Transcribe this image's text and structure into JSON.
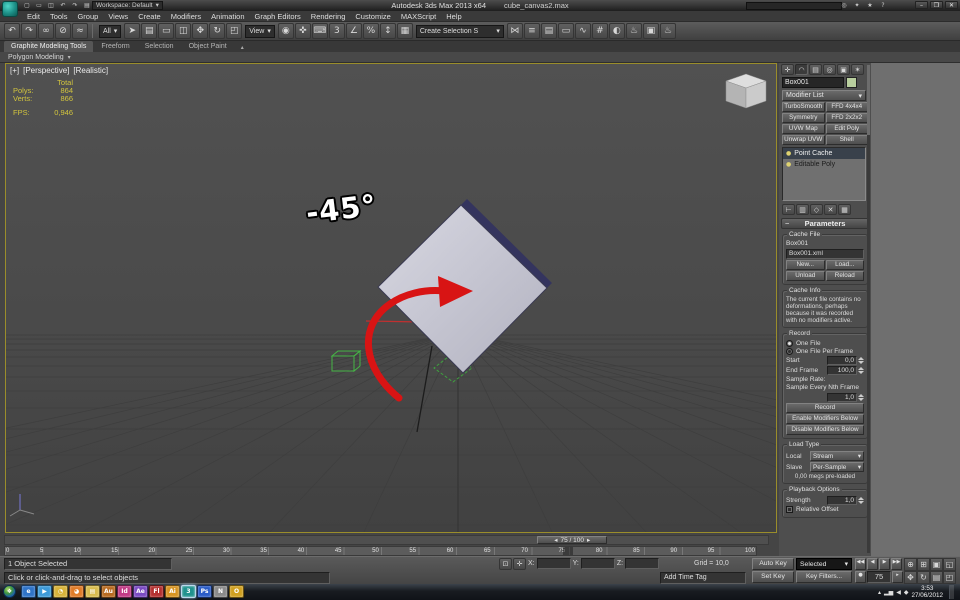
{
  "glyphs": {
    "chevron_down": "▾",
    "chevron_up": "▴",
    "slider_left": "◂",
    "slider_right": "▸",
    "minus": "−",
    "bullet": "●"
  },
  "titlebar": {
    "workspace": "Workspace: Default",
    "app_title": "Autodesk 3ds Max 2013 x64",
    "file_name": "cube_canvas2.max",
    "quick_icons": [
      {
        "name": "new-scene-icon",
        "glyph": "▢"
      },
      {
        "name": "open-file-icon",
        "glyph": "▭"
      },
      {
        "name": "save-file-icon",
        "glyph": "◫"
      },
      {
        "name": "undo-icon",
        "glyph": "↶"
      },
      {
        "name": "redo-icon",
        "glyph": "↷"
      },
      {
        "name": "project-folder-icon",
        "glyph": "▤"
      }
    ],
    "help_icons": [
      {
        "name": "search-icon",
        "glyph": "◎"
      },
      {
        "name": "communication-center-icon",
        "glyph": "✦"
      },
      {
        "name": "favorites-icon",
        "glyph": "★"
      },
      {
        "name": "help-icon",
        "glyph": "?"
      }
    ],
    "window_buttons": [
      {
        "name": "minimize-button",
        "glyph": "–"
      },
      {
        "name": "maximize-button",
        "glyph": "❒"
      },
      {
        "name": "close-button",
        "glyph": "✕"
      }
    ]
  },
  "menubar": {
    "items": [
      "Edit",
      "Tools",
      "Group",
      "Views",
      "Create",
      "Modifiers",
      "Animation",
      "Graph Editors",
      "Rendering",
      "Customize",
      "MAXScript",
      "Help"
    ]
  },
  "toolbar": {
    "group_a": [
      {
        "name": "undo-icon",
        "glyph": "↶"
      },
      {
        "name": "redo-icon",
        "glyph": "↷"
      },
      {
        "name": "select-and-link-icon",
        "glyph": "∞"
      },
      {
        "name": "unlink-selection-icon",
        "glyph": "⊘"
      },
      {
        "name": "bind-to-space-warp-icon",
        "glyph": "≈"
      }
    ],
    "filter_value": "All",
    "group_b": [
      {
        "name": "select-object-icon",
        "glyph": "➤"
      },
      {
        "name": "select-by-name-icon",
        "glyph": "▤"
      },
      {
        "name": "rectangular-selection-region-icon",
        "glyph": "▭"
      },
      {
        "name": "window-crossing-icon",
        "glyph": "◫"
      },
      {
        "name": "select-and-move-icon",
        "glyph": "✥"
      },
      {
        "name": "select-and-rotate-icon",
        "glyph": "↻"
      },
      {
        "name": "select-and-scale-icon",
        "glyph": "◰"
      }
    ],
    "refcoord_value": "View",
    "group_c": [
      {
        "name": "use-pivot-point-center-icon",
        "glyph": "◉"
      },
      {
        "name": "select-and-manipulate-icon",
        "glyph": "✜"
      },
      {
        "name": "keyboard-shortcut-override-icon",
        "glyph": "⌨"
      },
      {
        "name": "snaps-toggle-icon",
        "glyph": "3"
      },
      {
        "name": "angle-snap-icon",
        "glyph": "∠"
      },
      {
        "name": "percent-snap-icon",
        "glyph": "%"
      },
      {
        "name": "spinner-snap-icon",
        "glyph": "↕"
      },
      {
        "name": "edit-named-selection-sets-icon",
        "glyph": "▦"
      }
    ],
    "named_selection_value": "Create Selection S",
    "group_d": [
      {
        "name": "mirror-icon",
        "glyph": "⋈"
      },
      {
        "name": "align-icon",
        "glyph": "≡"
      },
      {
        "name": "layer-manager-icon",
        "glyph": "▤"
      },
      {
        "name": "graphite-toggle-icon",
        "glyph": "▭"
      },
      {
        "name": "curve-editor-icon",
        "glyph": "∿"
      },
      {
        "name": "schematic-view-icon",
        "glyph": "#"
      },
      {
        "name": "material-editor-icon",
        "glyph": "◐"
      },
      {
        "name": "render-setup-icon",
        "glyph": "♨"
      },
      {
        "name": "rendered-frame-icon",
        "glyph": "▣"
      },
      {
        "name": "render-production-icon",
        "glyph": "♨"
      }
    ]
  },
  "ribbon": {
    "tabs": [
      "Graphite Modeling Tools",
      "Freeform",
      "Selection",
      "Object Paint"
    ],
    "panel": "Polygon Modeling"
  },
  "viewport": {
    "plus": "[+]",
    "view_label": "[Perspective]",
    "shading_label": "[Realistic]",
    "stats": {
      "total": "Total",
      "polys_label": "Polys:",
      "polys_value": "864",
      "verts_label": "Verts:",
      "verts_value": "866",
      "fps_label": "FPS:",
      "fps_value": "0,946"
    },
    "annotation": "-45°"
  },
  "command_panel": {
    "tabs": [
      {
        "name": "create-tab-icon",
        "glyph": "✛"
      },
      {
        "name": "modify-tab-icon",
        "glyph": "◠"
      },
      {
        "name": "hierarchy-tab-icon",
        "glyph": "▤"
      },
      {
        "name": "motion-tab-icon",
        "glyph": "◎"
      },
      {
        "name": "display-tab-icon",
        "glyph": "▣"
      },
      {
        "name": "utilities-tab-icon",
        "glyph": "✶"
      }
    ],
    "object_name": "Box001",
    "modifier_list": "Modifier List",
    "modifier_buttons": [
      "TurboSmooth",
      "FFD 4x4x4",
      "Symmetry",
      "FFD 2x2x2",
      "UVW Map",
      "Edit Poly",
      "Unwrap UVW",
      "Shell"
    ],
    "stack": [
      "Point Cache",
      "Editable Poly"
    ],
    "stack_ops": [
      {
        "name": "pin-stack-icon",
        "glyph": "⊢"
      },
      {
        "name": "show-end-result-icon",
        "glyph": "▥"
      },
      {
        "name": "make-unique-icon",
        "glyph": "◇"
      },
      {
        "name": "remove-modifier-icon",
        "glyph": "✕"
      },
      {
        "name": "configure-modifier-sets-icon",
        "glyph": "▦"
      }
    ],
    "rollout_title": "Parameters",
    "cache_file": {
      "title": "Cache File",
      "record_name": "Box001",
      "file": "Box001.xml",
      "new": "New...",
      "load": "Load...",
      "unload": "Unload",
      "reload": "Reload"
    },
    "cache_info": {
      "title": "Cache Info",
      "text": "The current file contains no deformations, perhaps because it was recorded with no modifiers active."
    },
    "record": {
      "title": "Record",
      "one_file": "One File",
      "one_file_per_frame": "One File Per Frame",
      "start_label": "Start",
      "start": "0,0",
      "end_label": "End Frame",
      "end": "100,0",
      "sample_rate": "Sample Rate:",
      "sample_every": "Sample Every Nth Frame",
      "sample": "1,0",
      "record_button": "Record",
      "enable": "Enable Modifiers Below",
      "disable": "Disable Modifiers Below"
    },
    "load_type": {
      "title": "Load Type",
      "local_label": "Local",
      "local": "Stream",
      "slave_label": "Slave",
      "slave": "Per-Sample",
      "preloaded": "0,00 megs pre-loaded"
    },
    "playback": {
      "title": "Playback Options",
      "strength_label": "Strength",
      "strength": "1,0",
      "relative": "Relative Offset"
    }
  },
  "timeline": {
    "slider": "75 / 100",
    "ticks": [
      "0",
      "5",
      "10",
      "15",
      "20",
      "25",
      "30",
      "35",
      "40",
      "45",
      "50",
      "55",
      "60",
      "65",
      "70",
      "75",
      "80",
      "85",
      "90",
      "95",
      "100"
    ]
  },
  "status": {
    "selection": "1 Object Selected",
    "prompt": "Click or click-and-drag to select objects",
    "lock_glyph": "⊡",
    "absolute_mode_glyph": "✛",
    "x_label": "X:",
    "y_label": "Y:",
    "z_label": "Z:",
    "x_value": "",
    "y_value": "",
    "z_value": "",
    "grid": "Grid = 10,0",
    "add_time_tag": "Add Time Tag",
    "auto_key": "Auto Key",
    "set_key": "Set Key",
    "selected_filter": "Selected",
    "key_filters": "Key Filters...",
    "frame_value": "75",
    "key_mode_glyph": "●",
    "playback_icons": [
      {
        "name": "go-to-start-icon",
        "glyph": "◀◀"
      },
      {
        "name": "previous-frame-icon",
        "glyph": "◀"
      },
      {
        "name": "play-icon",
        "glyph": "▶"
      },
      {
        "name": "go-to-end-icon",
        "glyph": "▶▶"
      }
    ],
    "nav_icons": [
      {
        "name": "zoom-icon",
        "glyph": "⊕"
      },
      {
        "name": "zoom-all-icon",
        "glyph": "⊞"
      },
      {
        "name": "zoom-extents-icon",
        "glyph": "▣"
      },
      {
        "name": "zoom-region-icon",
        "glyph": "◱"
      },
      {
        "name": "pan-icon",
        "glyph": "✥"
      },
      {
        "name": "orbit-icon",
        "glyph": "↻"
      },
      {
        "name": "field-of-view-icon",
        "glyph": "▤"
      },
      {
        "name": "maximize-viewport-icon",
        "glyph": "◰"
      }
    ]
  },
  "taskbar": {
    "start_glyph": "❖",
    "icons": [
      {
        "name": "taskbar-internet-explorer-icon",
        "letter": "e",
        "color": "#2f74c8"
      },
      {
        "name": "taskbar-media-player-icon",
        "letter": "▶",
        "color": "#3d9ad8"
      },
      {
        "name": "taskbar-chrome-icon",
        "letter": "◔",
        "color": "#d8b33a"
      },
      {
        "name": "taskbar-firefox-icon",
        "letter": "◕",
        "color": "#e07b28"
      },
      {
        "name": "taskbar-explorer-icon",
        "letter": "▤",
        "color": "#d8bc4e"
      },
      {
        "name": "taskbar-audition-icon",
        "letter": "Au",
        "color": "#b86a20"
      },
      {
        "name": "taskbar-indesign-icon",
        "letter": "Id",
        "color": "#c23a86"
      },
      {
        "name": "taskbar-after-effects-icon",
        "letter": "Ae",
        "color": "#7a4ac2"
      },
      {
        "name": "taskbar-flash-icon",
        "letter": "Fl",
        "color": "#b43030"
      },
      {
        "name": "taskbar-illustrator-icon",
        "letter": "Ai",
        "color": "#d89420"
      },
      {
        "name": "taskbar-3ds-max-icon",
        "letter": "3",
        "color": "#20928e"
      },
      {
        "name": "taskbar-photoshop-icon",
        "letter": "Ps",
        "color": "#2a5cc8"
      },
      {
        "name": "taskbar-notepad-icon",
        "letter": "N",
        "color": "#8a8a8a"
      },
      {
        "name": "taskbar-outlook-icon",
        "letter": "O",
        "color": "#d0a020"
      }
    ],
    "tray_icons": [
      {
        "name": "tray-expand-icon",
        "glyph": "▴"
      },
      {
        "name": "tray-network-icon",
        "glyph": "▂▅"
      },
      {
        "name": "tray-volume-icon",
        "glyph": "◀"
      },
      {
        "name": "tray-action-center-icon",
        "glyph": "◆"
      }
    ],
    "time": "3:53",
    "date": "27/06/2012"
  }
}
